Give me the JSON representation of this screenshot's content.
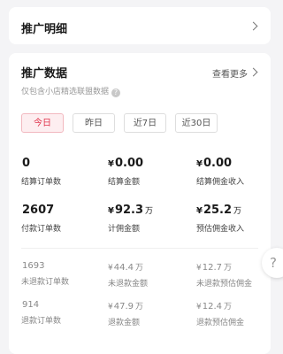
{
  "detail": {
    "title": "推广明细"
  },
  "data_section": {
    "title": "推广数据",
    "more": "查看更多",
    "subtitle": "仅包含小店精选联盟数据",
    "help_glyph": "?"
  },
  "tabs": [
    {
      "label": "今日",
      "active": true
    },
    {
      "label": "昨日",
      "active": false
    },
    {
      "label": "近7日",
      "active": false
    },
    {
      "label": "近30日",
      "active": false
    }
  ],
  "metrics_primary": [
    {
      "currency": "",
      "value": "0",
      "unit": "",
      "label": "结算订单数"
    },
    {
      "currency": "¥",
      "value": "0.00",
      "unit": "",
      "label": "结算金额"
    },
    {
      "currency": "¥",
      "value": "0.00",
      "unit": "",
      "label": "结算佣金收入"
    },
    {
      "currency": "",
      "value": "2607",
      "unit": "",
      "label": "付款订单数"
    },
    {
      "currency": "¥",
      "value": "92.3",
      "unit": "万",
      "label": "计佣金额"
    },
    {
      "currency": "¥",
      "value": "25.2",
      "unit": "万",
      "label": "预估佣金收入"
    }
  ],
  "metrics_secondary": [
    {
      "currency": "",
      "value": "1693",
      "unit": "",
      "label": "未退款订单数"
    },
    {
      "currency": "¥",
      "value": "44.4",
      "unit": "万",
      "label": "未退款金额"
    },
    {
      "currency": "¥",
      "value": "12.7",
      "unit": "万",
      "label": "未退款预估佣金"
    },
    {
      "currency": "",
      "value": "914",
      "unit": "",
      "label": "退款订单数"
    },
    {
      "currency": "¥",
      "value": "47.9",
      "unit": "万",
      "label": "退款金额"
    },
    {
      "currency": "¥",
      "value": "12.4",
      "unit": "万",
      "label": "退款预估佣金"
    }
  ],
  "floating_help": "?"
}
